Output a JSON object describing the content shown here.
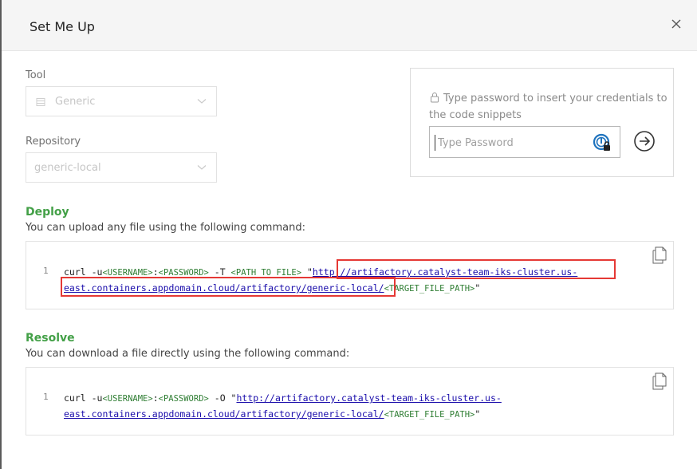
{
  "dialog": {
    "title": "Set Me Up"
  },
  "tool": {
    "label": "Tool",
    "value": "Generic"
  },
  "repository": {
    "label": "Repository",
    "value": "generic-local"
  },
  "credentials": {
    "hint": "Type password to insert your credentials to the code snippets",
    "password_placeholder": "Type Password"
  },
  "deploy": {
    "title": "Deploy",
    "description": "You can upload any file using the following command:",
    "line_number": "1",
    "cmd": "curl -u",
    "user_ph": "<USERNAME>",
    "colon": ":",
    "pass_ph": "<PASSWORD>",
    "flag": " -T ",
    "path_ph": "<PATH_TO_FILE>",
    "quote_open": " \"",
    "url_line1": "http://artifactory.catalyst-team-iks-cluster.us-",
    "url_line2": "east.containers.appdomain.cloud/artifactory/generic-local/",
    "target_ph": "<TARGET_FILE_PATH>",
    "quote_close": "\""
  },
  "resolve": {
    "title": "Resolve",
    "description": "You can download a file directly using the following command:",
    "line_number": "1",
    "cmd": "curl -u",
    "user_ph": "<USERNAME>",
    "colon": ":",
    "pass_ph": "<PASSWORD>",
    "flag": " -O ",
    "quote_open": "\"",
    "url_line1": "http://artifactory.catalyst-team-iks-cluster.us-",
    "url_line2": "east.containers.appdomain.cloud/artifactory/generic-local/",
    "target_ph": "<TARGET_FILE_PATH>",
    "quote_close": "\""
  },
  "colors": {
    "section_title": "#43a047",
    "placeholder_token": "#2e7d32",
    "link": "#1a0dab",
    "highlight": "#e53935"
  }
}
